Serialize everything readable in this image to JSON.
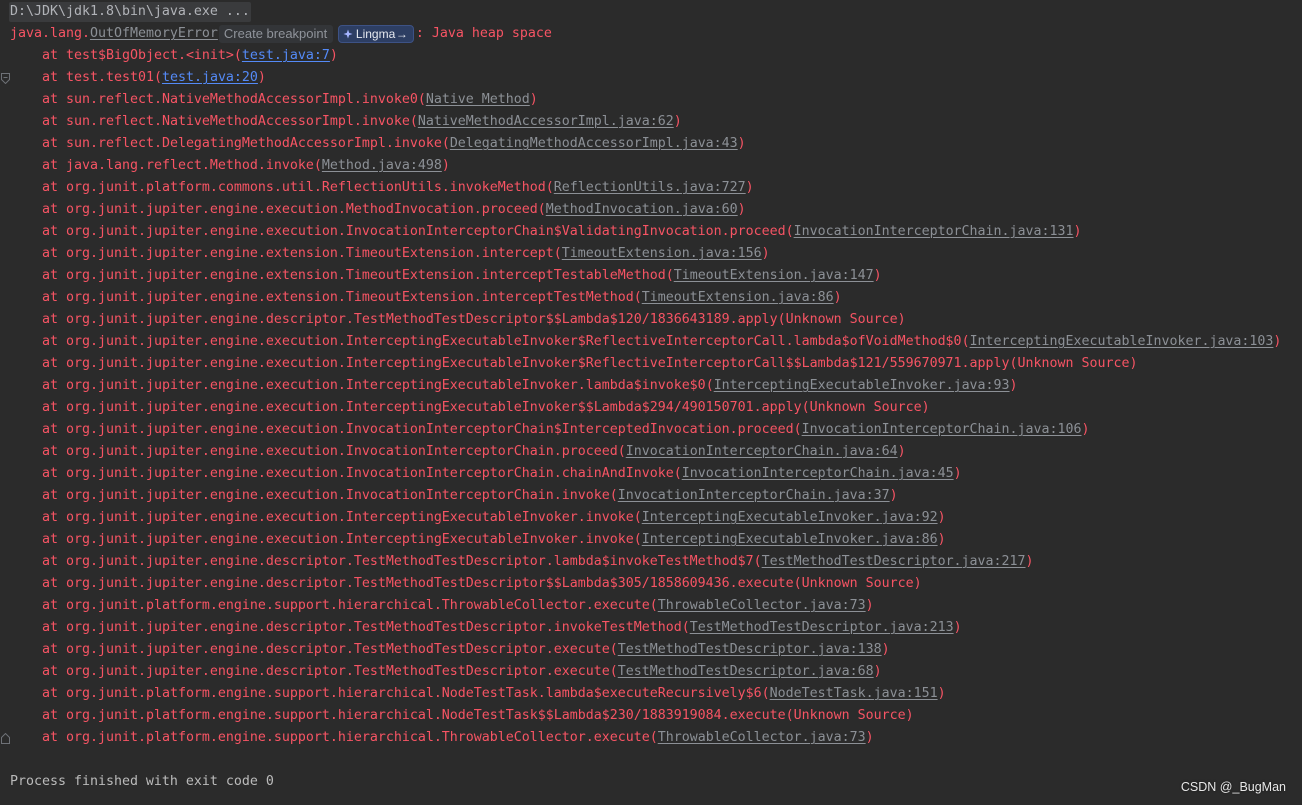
{
  "console": {
    "command_line": "D:\\JDK\\jdk1.8\\bin\\java.exe ...",
    "exception": {
      "package": "java.lang.",
      "class_name": "OutOfMemoryError",
      "breakpoint_hint": "Create breakpoint",
      "ai_action": {
        "label": "Lingma",
        "arrow": "→",
        "icon": "lingma-logo-icon"
      },
      "message": ": Java heap space"
    },
    "frame_prefix": "at",
    "stack": [
      {
        "method": "test$BigObject.<init>",
        "source": "test.java:7",
        "project": true
      },
      {
        "method": "test.test01",
        "source": "test.java:20",
        "project": true
      },
      {
        "method": "sun.reflect.NativeMethodAccessorImpl.invoke0",
        "source": "Native Method"
      },
      {
        "method": "sun.reflect.NativeMethodAccessorImpl.invoke",
        "source": "NativeMethodAccessorImpl.java:62"
      },
      {
        "method": "sun.reflect.DelegatingMethodAccessorImpl.invoke",
        "source": "DelegatingMethodAccessorImpl.java:43"
      },
      {
        "method": "java.lang.reflect.Method.invoke",
        "source": "Method.java:498"
      },
      {
        "method": "org.junit.platform.commons.util.ReflectionUtils.invokeMethod",
        "source": "ReflectionUtils.java:727"
      },
      {
        "method": "org.junit.jupiter.engine.execution.MethodInvocation.proceed",
        "source": "MethodInvocation.java:60"
      },
      {
        "method": "org.junit.jupiter.engine.execution.InvocationInterceptorChain$ValidatingInvocation.proceed",
        "source": "InvocationInterceptorChain.java:131"
      },
      {
        "method": "org.junit.jupiter.engine.extension.TimeoutExtension.intercept",
        "source": "TimeoutExtension.java:156"
      },
      {
        "method": "org.junit.jupiter.engine.extension.TimeoutExtension.interceptTestableMethod",
        "source": "TimeoutExtension.java:147"
      },
      {
        "method": "org.junit.jupiter.engine.extension.TimeoutExtension.interceptTestMethod",
        "source": "TimeoutExtension.java:86"
      },
      {
        "method": "org.junit.jupiter.engine.descriptor.TestMethodTestDescriptor$$Lambda$120/1836643189.apply",
        "source": "Unknown Source",
        "linked": false
      },
      {
        "method": "org.junit.jupiter.engine.execution.InterceptingExecutableInvoker$ReflectiveInterceptorCall.lambda$ofVoidMethod$0",
        "source": "InterceptingExecutableInvoker.java:103"
      },
      {
        "method": "org.junit.jupiter.engine.execution.InterceptingExecutableInvoker$ReflectiveInterceptorCall$$Lambda$121/559670971.apply",
        "source": "Unknown Source",
        "linked": false
      },
      {
        "method": "org.junit.jupiter.engine.execution.InterceptingExecutableInvoker.lambda$invoke$0",
        "source": "InterceptingExecutableInvoker.java:93"
      },
      {
        "method": "org.junit.jupiter.engine.execution.InterceptingExecutableInvoker$$Lambda$294/490150701.apply",
        "source": "Unknown Source",
        "linked": false
      },
      {
        "method": "org.junit.jupiter.engine.execution.InvocationInterceptorChain$InterceptedInvocation.proceed",
        "source": "InvocationInterceptorChain.java:106"
      },
      {
        "method": "org.junit.jupiter.engine.execution.InvocationInterceptorChain.proceed",
        "source": "InvocationInterceptorChain.java:64"
      },
      {
        "method": "org.junit.jupiter.engine.execution.InvocationInterceptorChain.chainAndInvoke",
        "source": "InvocationInterceptorChain.java:45"
      },
      {
        "method": "org.junit.jupiter.engine.execution.InvocationInterceptorChain.invoke",
        "source": "InvocationInterceptorChain.java:37"
      },
      {
        "method": "org.junit.jupiter.engine.execution.InterceptingExecutableInvoker.invoke",
        "source": "InterceptingExecutableInvoker.java:92"
      },
      {
        "method": "org.junit.jupiter.engine.execution.InterceptingExecutableInvoker.invoke",
        "source": "InterceptingExecutableInvoker.java:86"
      },
      {
        "method": "org.junit.jupiter.engine.descriptor.TestMethodTestDescriptor.lambda$invokeTestMethod$7",
        "source": "TestMethodTestDescriptor.java:217"
      },
      {
        "method": "org.junit.jupiter.engine.descriptor.TestMethodTestDescriptor$$Lambda$305/1858609436.execute",
        "source": "Unknown Source",
        "linked": false
      },
      {
        "method": "org.junit.platform.engine.support.hierarchical.ThrowableCollector.execute",
        "source": "ThrowableCollector.java:73"
      },
      {
        "method": "org.junit.jupiter.engine.descriptor.TestMethodTestDescriptor.invokeTestMethod",
        "source": "TestMethodTestDescriptor.java:213"
      },
      {
        "method": "org.junit.jupiter.engine.descriptor.TestMethodTestDescriptor.execute",
        "source": "TestMethodTestDescriptor.java:138"
      },
      {
        "method": "org.junit.jupiter.engine.descriptor.TestMethodTestDescriptor.execute",
        "source": "TestMethodTestDescriptor.java:68"
      },
      {
        "method": "org.junit.platform.engine.support.hierarchical.NodeTestTask.lambda$executeRecursively$6",
        "source": "NodeTestTask.java:151"
      },
      {
        "method": "org.junit.platform.engine.support.hierarchical.NodeTestTask$$Lambda$230/1883919084.execute",
        "source": "Unknown Source",
        "linked": false
      },
      {
        "method": "org.junit.platform.engine.support.hierarchical.ThrowableCollector.execute",
        "source": "ThrowableCollector.java:73"
      }
    ],
    "exit_message": "Process finished with exit code 0"
  },
  "gutter": {
    "fold_start_icon": "fold-start-icon",
    "fold_end_icon": "fold-end-icon"
  },
  "watermark": "CSDN @_BugMan",
  "colors": {
    "background": "#2b2b2b",
    "error_text": "#f75464",
    "project_link": "#548af7",
    "library_link": "#8c9096",
    "normal_text": "#bbbbbb",
    "folded_text": "#b1b3b8",
    "hint_text": "#8f939a",
    "watermark": "#e8e8e8"
  }
}
